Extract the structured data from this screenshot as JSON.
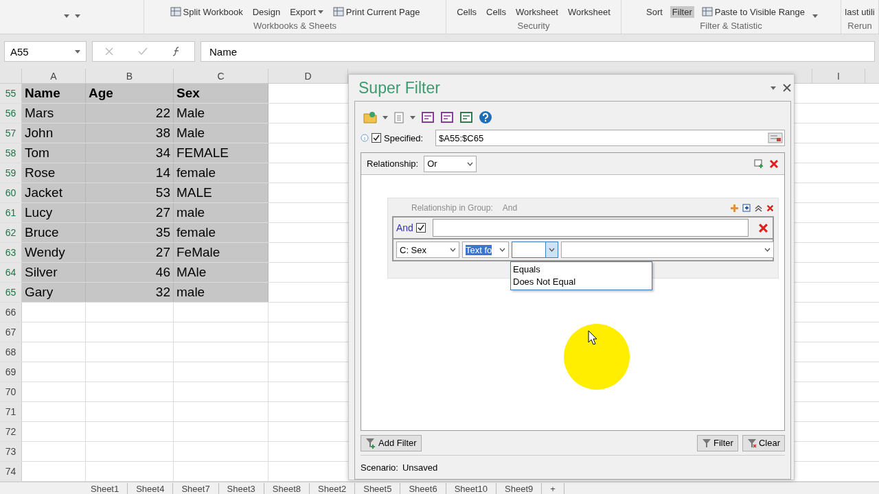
{
  "ribbon": {
    "groups": [
      {
        "items": [
          {
            "kind": "caret"
          },
          {
            "kind": "caret"
          }
        ]
      },
      {
        "label": "Workbooks & Sheets",
        "items": [
          {
            "kind": "icon-button",
            "label": "Split Workbook",
            "pressed": false
          },
          {
            "kind": "button",
            "label": "Design",
            "pressed": false
          },
          {
            "kind": "menu-button",
            "label": "Export",
            "pressed": false
          },
          {
            "kind": "icon-button",
            "label": "Print Current Page",
            "pressed": false
          }
        ]
      },
      {
        "label": "Security",
        "items": [
          {
            "kind": "button",
            "label": "Cells",
            "pressed": false
          },
          {
            "kind": "button",
            "label": "Cells",
            "pressed": false
          },
          {
            "kind": "button",
            "label": "Worksheet",
            "pressed": false
          },
          {
            "kind": "button",
            "label": "Worksheet",
            "pressed": false
          }
        ]
      },
      {
        "label": "Filter & Statistic",
        "items": [
          {
            "kind": "button",
            "label": "Sort",
            "pressed": false
          },
          {
            "kind": "button",
            "label": "Filter",
            "pressed": true
          },
          {
            "kind": "icon-button",
            "label": "Paste to Visible Range",
            "pressed": false
          },
          {
            "kind": "caret"
          }
        ]
      },
      {
        "label": "Rerun",
        "items": [
          {
            "kind": "button",
            "label": "last utili",
            "pressed": false
          }
        ]
      }
    ]
  },
  "formula_bar": {
    "name_box": "A55",
    "formula": "Name"
  },
  "columns": [
    "A",
    "B",
    "C",
    "D",
    "I"
  ],
  "rows": [
    {
      "number": "55",
      "kind": "header",
      "selected": true,
      "cells": [
        "Name",
        "Age",
        "Sex"
      ]
    },
    {
      "number": "56",
      "kind": "data",
      "selected": true,
      "cells": [
        "Mars",
        "22",
        "Male"
      ]
    },
    {
      "number": "57",
      "kind": "data",
      "selected": true,
      "cells": [
        "John",
        "38",
        "Male"
      ]
    },
    {
      "number": "58",
      "kind": "data",
      "selected": true,
      "cells": [
        "Tom",
        "34",
        "FEMALE"
      ]
    },
    {
      "number": "59",
      "kind": "data",
      "selected": true,
      "cells": [
        "Rose",
        "14",
        "female"
      ]
    },
    {
      "number": "60",
      "kind": "data",
      "selected": true,
      "cells": [
        "Jacket",
        "53",
        "MALE"
      ]
    },
    {
      "number": "61",
      "kind": "data",
      "selected": true,
      "cells": [
        "Lucy",
        "27",
        "male"
      ]
    },
    {
      "number": "62",
      "kind": "data",
      "selected": true,
      "cells": [
        "Bruce",
        "35",
        "female"
      ]
    },
    {
      "number": "63",
      "kind": "data",
      "selected": true,
      "cells": [
        "Wendy",
        "27",
        "FeMale"
      ]
    },
    {
      "number": "64",
      "kind": "data",
      "selected": true,
      "cells": [
        "Silver",
        "46",
        "MAle"
      ]
    },
    {
      "number": "65",
      "kind": "data",
      "selected": true,
      "cells": [
        "Gary",
        "32",
        "male"
      ]
    },
    {
      "number": "66",
      "kind": "data",
      "selected": false,
      "cells": []
    },
    {
      "number": "67",
      "kind": "data",
      "selected": false,
      "cells": []
    },
    {
      "number": "68",
      "kind": "data",
      "selected": false,
      "cells": []
    },
    {
      "number": "69",
      "kind": "data",
      "selected": false,
      "cells": []
    },
    {
      "number": "70",
      "kind": "data",
      "selected": false,
      "cells": []
    },
    {
      "number": "71",
      "kind": "data",
      "selected": false,
      "cells": []
    },
    {
      "number": "72",
      "kind": "data",
      "selected": false,
      "cells": []
    },
    {
      "number": "73",
      "kind": "data",
      "selected": false,
      "cells": []
    },
    {
      "number": "74",
      "kind": "data",
      "selected": false,
      "cells": []
    }
  ],
  "sheet_tabs": [
    {
      "label": "Sheet1",
      "selected": false
    },
    {
      "label": "Sheet4",
      "selected": false
    },
    {
      "label": "Sheet7",
      "selected": false
    },
    {
      "label": "Sheet3",
      "selected": false
    },
    {
      "label": "Sheet8",
      "selected": false
    },
    {
      "label": "Sheet2",
      "selected": false
    },
    {
      "label": "Sheet5",
      "selected": false
    },
    {
      "label": "Sheet6",
      "selected": false
    },
    {
      "label": "Sheet10",
      "selected": false
    },
    {
      "label": "Sheet9",
      "selected": false
    }
  ],
  "add_sheet": "+",
  "super_filter": {
    "title": "Super Filter",
    "specified": {
      "label": "Specified:",
      "checked": true,
      "range": "$A55:$C65"
    },
    "relationship": {
      "label": "Relationship:",
      "value": "Or"
    },
    "group": {
      "label": "Relationship in Group:",
      "value": "And",
      "disabled": true,
      "condition_header": {
        "label": "And",
        "checked": true
      },
      "condition": {
        "column": "C: Sex",
        "type": "Text fo",
        "open": true,
        "options": [
          "Equals",
          "Does Not Equal"
        ]
      }
    },
    "buttons": {
      "add": "Add Filter",
      "filter": "Filter",
      "clear": "Clear"
    },
    "scenario": {
      "label": "Scenario:",
      "value": "Unsaved"
    }
  }
}
